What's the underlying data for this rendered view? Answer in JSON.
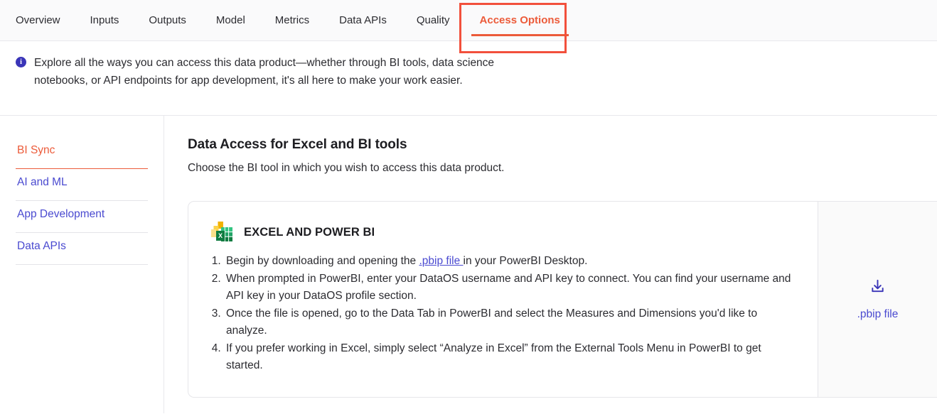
{
  "topnav": {
    "items": [
      {
        "label": "Overview",
        "active": false
      },
      {
        "label": "Inputs",
        "active": false
      },
      {
        "label": "Outputs",
        "active": false
      },
      {
        "label": "Model",
        "active": false
      },
      {
        "label": "Metrics",
        "active": false
      },
      {
        "label": "Data APIs",
        "active": false
      },
      {
        "label": "Quality",
        "active": false
      },
      {
        "label": "Access Options",
        "active": true
      }
    ],
    "annotation_color": "#f2503c",
    "active_color": "#ec5b3a"
  },
  "banner": {
    "icon": "info-icon",
    "icon_glyph": "i",
    "icon_color": "#3a35b8",
    "text": "Explore all the ways you can access this data product—whether through BI tools, data science notebooks, or API endpoints for app development, it's all here to make your work easier."
  },
  "sidebar": {
    "items": [
      {
        "label": "BI Sync",
        "active": true
      },
      {
        "label": "AI and ML",
        "active": false
      },
      {
        "label": "App Development",
        "active": false
      },
      {
        "label": "Data APIs",
        "active": false
      }
    ],
    "link_color": "#4a4ad0"
  },
  "main": {
    "title": "Data Access for Excel and BI tools",
    "subtitle": "Choose the BI tool in which you wish to access this data product."
  },
  "card": {
    "icon": "excel-powerbi-icon",
    "title": "EXCEL AND POWER BI",
    "steps": [
      {
        "pre": "Begin by downloading and opening the ",
        "link": ".pbip file ",
        "post": "in your PowerBI Desktop."
      },
      {
        "pre": "When prompted in PowerBI, enter your DataOS username and API key to connect. You can find your username and API key in your DataOS profile section.",
        "link": "",
        "post": ""
      },
      {
        "pre": "Once the file is opened, go to the Data Tab in PowerBI and select the Measures and Dimensions you'd like to analyze.",
        "link": "",
        "post": ""
      },
      {
        "pre": "If you prefer working in Excel, simply select “Analyze in Excel” from the External Tools Menu in PowerBI to get started.",
        "link": "",
        "post": ""
      }
    ],
    "download": {
      "icon": "download-icon",
      "label": ".pbip file"
    }
  }
}
